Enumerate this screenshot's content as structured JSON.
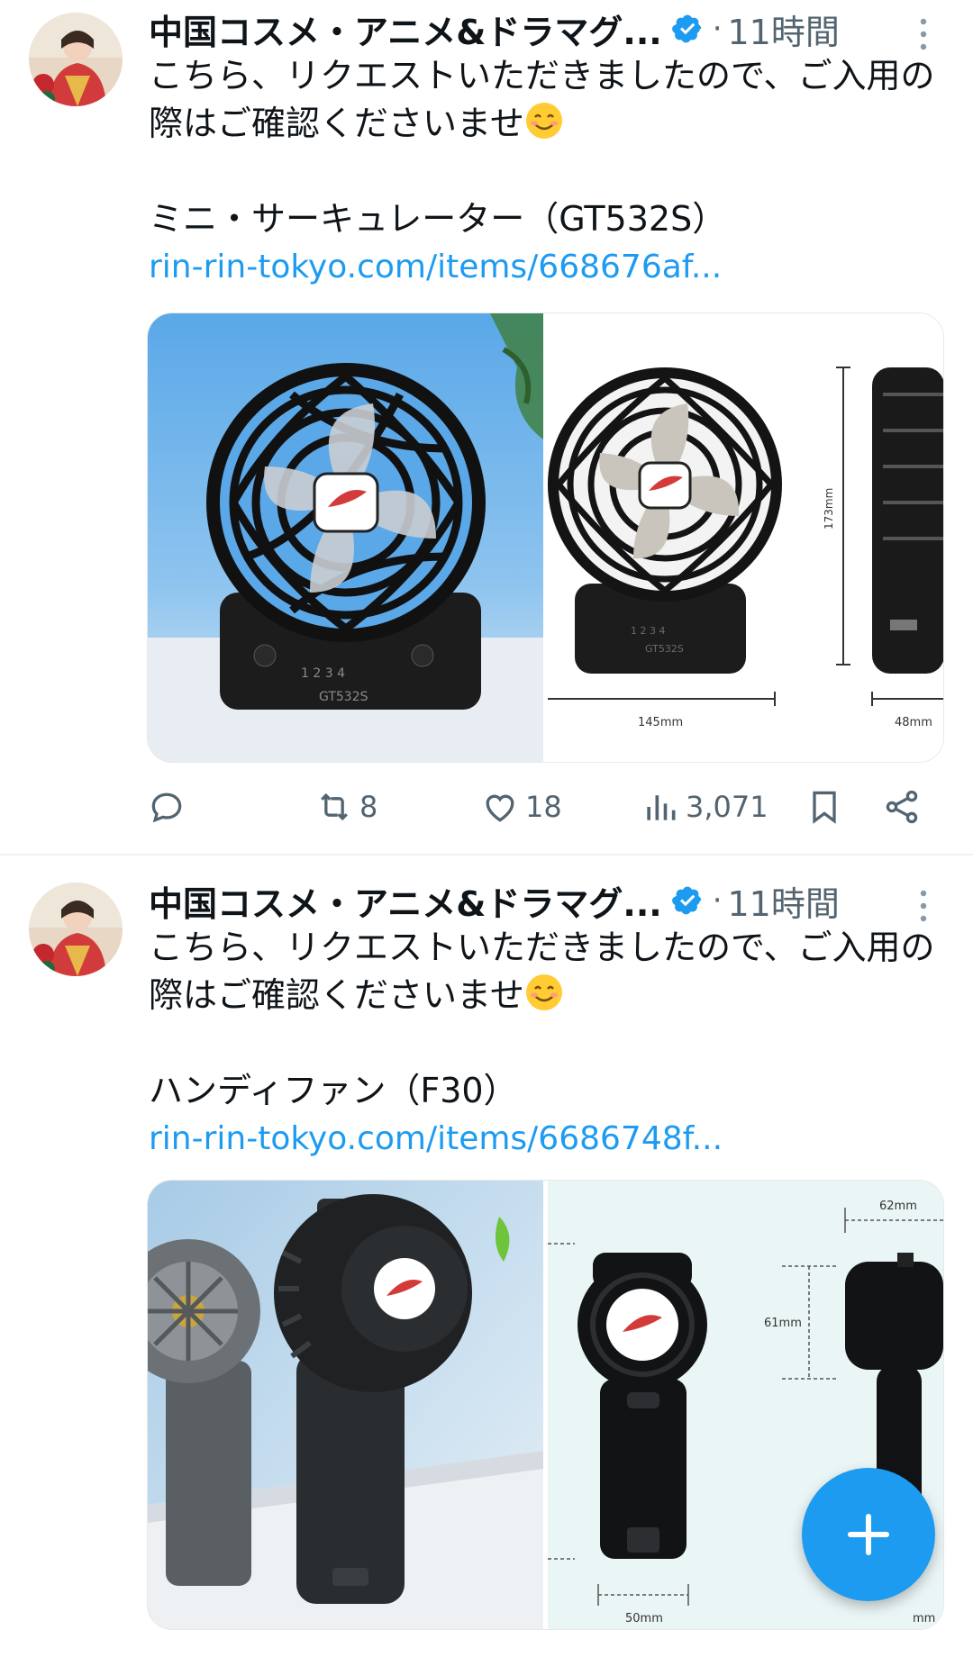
{
  "tweets": [
    {
      "display_name": "中国コスメ・アニメ&ドラマグ...",
      "time": "11時間",
      "text": "こちら、リクエストいただきましたので、ご入用の際はご確認くださいませ",
      "product": "ミニ・サーキュレーター（GT532S）",
      "link": "rin-rin-tokyo.com/items/668676af...",
      "image_labels": {
        "height": "173mm",
        "width": "145mm",
        "depth": "48mm",
        "model": "GT532S"
      },
      "actions": {
        "retweets": "8",
        "likes": "18",
        "views": "3,071"
      }
    },
    {
      "display_name": "中国コスメ・アニメ&ドラマグ...",
      "time": "11時間",
      "text": "こちら、リクエストいただきましたので、ご入用の際はご確認くださいませ",
      "product": "ハンディファン（F30）",
      "link": "rin-rin-tokyo.com/items/6686748f...",
      "image_labels": {
        "top": "62mm",
        "height": "61mm",
        "width": "50mm",
        "right": "mm"
      }
    }
  ],
  "icons": {
    "verified": "verified-badge-icon",
    "more": "more-vertical-icon",
    "reply": "reply-icon",
    "retweet": "retweet-icon",
    "like": "like-icon",
    "views": "views-icon",
    "bookmark": "bookmark-icon",
    "share": "share-icon",
    "compose": "compose-plus-icon"
  },
  "colors": {
    "accent": "#1d9bf0",
    "secondary_text": "#536471",
    "primary_text": "#0f1419"
  }
}
